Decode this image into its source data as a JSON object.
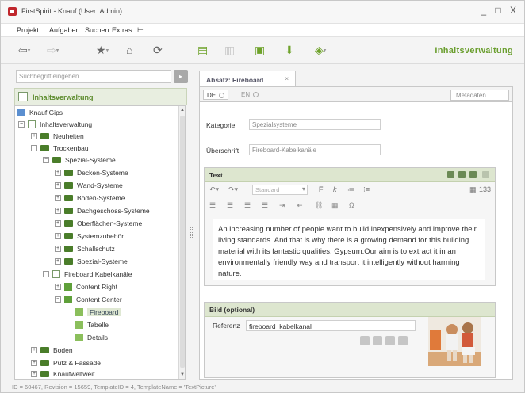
{
  "window": {
    "title": "FirstSpirit - Knauf (User: Admin)",
    "controls": "_ □ X"
  },
  "menu": [
    "Projekt",
    "Aufgaben",
    "Suchen",
    "Extras",
    "⊢"
  ],
  "toolbar": {
    "perspective": "Inhaltsverwaltung"
  },
  "search": {
    "placeholder": "Suchbegriff eingeben",
    "button": "Go"
  },
  "tree_header": "Inhaltsverwaltung",
  "tree": [
    {
      "label": "Knauf Gips",
      "icon": "project-icon",
      "expander": ""
    },
    {
      "label": "Inhaltsverwaltung",
      "icon": "page-icon",
      "expander": "−"
    },
    {
      "label": "Neuheiten",
      "icon": "folder-icon",
      "expander": "+"
    },
    {
      "label": "Trockenbau",
      "icon": "folder-icon",
      "expander": "−"
    },
    {
      "label": "Spezial-Systeme",
      "icon": "folder-icon",
      "expander": "−"
    },
    {
      "label": "Decken-Systeme",
      "icon": "folder-icon",
      "expander": "+"
    },
    {
      "label": "Wand-Systeme",
      "icon": "folder-icon",
      "expander": "+"
    },
    {
      "label": "Boden-Systeme",
      "icon": "folder-icon",
      "expander": "+"
    },
    {
      "label": "Dachgeschoss-Systeme",
      "icon": "folder-icon",
      "expander": "+"
    },
    {
      "label": "Oberflächen-Systeme",
      "icon": "folder-icon",
      "expander": "+"
    },
    {
      "label": "Systemzubehör",
      "icon": "folder-icon",
      "expander": "+"
    },
    {
      "label": "Schallschutz",
      "icon": "folder-icon",
      "expander": "+"
    },
    {
      "label": "Spezial-Systeme",
      "icon": "folder-icon",
      "expander": "+"
    },
    {
      "label": "Fireboard Kabelkanäle",
      "icon": "page-icon",
      "expander": "−"
    },
    {
      "label": "Content Right",
      "icon": "section-icon",
      "expander": "+"
    },
    {
      "label": "Content Center",
      "icon": "section-icon",
      "expander": "−"
    },
    {
      "label": "Fireboard",
      "icon": "section-icon",
      "expander": "",
      "selected": true
    },
    {
      "label": "Tabelle",
      "icon": "section-icon",
      "expander": ""
    },
    {
      "label": "Details",
      "icon": "section-icon",
      "expander": ""
    },
    {
      "label": "Boden",
      "icon": "folder-icon",
      "expander": "+"
    },
    {
      "label": "Putz & Fassade",
      "icon": "folder-icon",
      "expander": "+"
    },
    {
      "label": "Knaufweltweit",
      "icon": "folder-icon",
      "expander": "+"
    }
  ],
  "editor": {
    "tab_label": "Absatz: Fireboard",
    "tab_close": "×",
    "lang_de": "DE",
    "lang_en": "EN",
    "metadata": "Metadaten",
    "kategorie_label": "Kategorie",
    "kategorie_value": "Spezialsysteme",
    "ueberschrift_label": "Überschrift",
    "ueberschrift_value": "Fireboard-Kabelkanäle",
    "text_section": "Text",
    "style_select": "Standard",
    "char_count": "133",
    "text_body": "An increasing number of people want to build inexpensively and improve their living standards. And that is why there is a growing demand for this building material with its fantastic qualities: Gypsum.Our aim is to extract it in an environmentally friendly way and transport it intelligently without harming nature.",
    "bild_section": "Bild (optional)",
    "referenz_label": "Referenz",
    "referenz_value": "fireboard_kabelkanal"
  },
  "status": "ID = 60467, Revision = 15659, TemplateID = 4, TemplateName = 'TextPicture'"
}
